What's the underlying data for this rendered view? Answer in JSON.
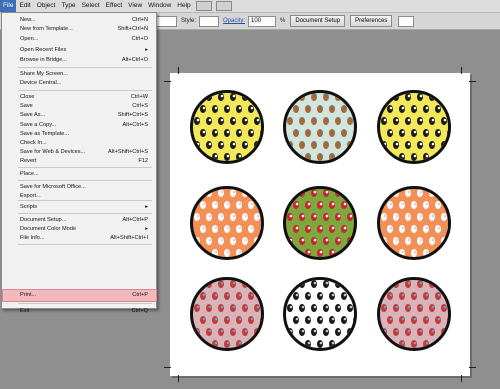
{
  "menubar": {
    "items": [
      "File",
      "Edit",
      "Object",
      "Type",
      "Select",
      "Effect",
      "View",
      "Window",
      "Help"
    ],
    "active": "File"
  },
  "controlbar": {
    "style_label": "Style:",
    "opacity_label": "Opacity:",
    "opacity_value": "100",
    "percent": "%",
    "document_setup": "Document Setup",
    "preferences": "Preferences"
  },
  "filemenu": {
    "items": [
      {
        "label": "New...",
        "shortcut": "Ctrl+N"
      },
      {
        "label": "New from Template...",
        "shortcut": "Shift+Ctrl+N"
      },
      {
        "label": "Open...",
        "shortcut": "Ctrl+O"
      },
      {
        "label": "Open Recent Files",
        "shortcut": "▸"
      },
      {
        "label": "Browse in Bridge...",
        "shortcut": "Alt+Ctrl+O"
      },
      {
        "label": "Share My Screen...",
        "shortcut": ""
      },
      {
        "label": "Device Central...",
        "shortcut": ""
      },
      {
        "label": "Close",
        "shortcut": "Ctrl+W"
      },
      {
        "label": "Save",
        "shortcut": "Ctrl+S"
      },
      {
        "label": "Save As...",
        "shortcut": "Shift+Ctrl+S"
      },
      {
        "label": "Save a Copy...",
        "shortcut": "Alt+Ctrl+S"
      },
      {
        "label": "Save as Template...",
        "shortcut": ""
      },
      {
        "label": "Check In...",
        "shortcut": ""
      },
      {
        "label": "Save for Web & Devices...",
        "shortcut": "Alt+Shift+Ctrl+S"
      },
      {
        "label": "Revert",
        "shortcut": "F12"
      },
      {
        "label": "Place...",
        "shortcut": ""
      },
      {
        "label": "Save for Microsoft Office...",
        "shortcut": ""
      },
      {
        "label": "Export...",
        "shortcut": ""
      },
      {
        "label": "Scripts",
        "shortcut": "▸"
      },
      {
        "label": "Document Setup...",
        "shortcut": "Alt+Ctrl+P"
      },
      {
        "label": "Document Color Mode",
        "shortcut": "▸"
      },
      {
        "label": "File Info...",
        "shortcut": "Alt+Shift+Ctrl+I"
      },
      {
        "label": "Print...",
        "shortcut": "Ctrl+P"
      },
      {
        "label": "Exit",
        "shortcut": "Ctrl+Q"
      }
    ]
  },
  "artboard": {
    "circles": [
      {
        "pattern": "penguins",
        "bg": "#f2e85a"
      },
      {
        "pattern": "reindeer",
        "bg": "#cfe6e0"
      },
      {
        "pattern": "penguins",
        "bg": "#f2e85a"
      },
      {
        "pattern": "polar-bears",
        "bg": "#f39057"
      },
      {
        "pattern": "santas",
        "bg": "#7ea83e"
      },
      {
        "pattern": "polar-bears",
        "bg": "#f39057"
      },
      {
        "pattern": "stockings",
        "bg": "#d9b3b8"
      },
      {
        "pattern": "snow-penguins",
        "bg": "#ffffff"
      },
      {
        "pattern": "stockings",
        "bg": "#d9b3b8"
      }
    ]
  },
  "colors": {
    "menu_active": "#3f6fb6",
    "print_highlight": "#f2b9bd"
  }
}
